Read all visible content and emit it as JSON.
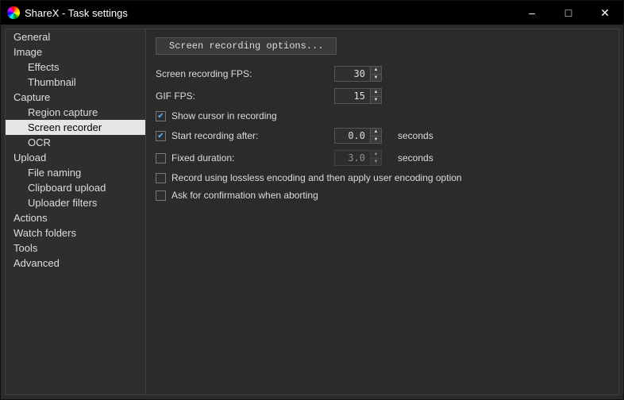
{
  "window": {
    "title": "ShareX - Task settings"
  },
  "sidebar": {
    "items": [
      {
        "label": "General",
        "child": false
      },
      {
        "label": "Image",
        "child": false
      },
      {
        "label": "Effects",
        "child": true
      },
      {
        "label": "Thumbnail",
        "child": true
      },
      {
        "label": "Capture",
        "child": false
      },
      {
        "label": "Region capture",
        "child": true
      },
      {
        "label": "Screen recorder",
        "child": true,
        "selected": true
      },
      {
        "label": "OCR",
        "child": true
      },
      {
        "label": "Upload",
        "child": false
      },
      {
        "label": "File naming",
        "child": true
      },
      {
        "label": "Clipboard upload",
        "child": true
      },
      {
        "label": "Uploader filters",
        "child": true
      },
      {
        "label": "Actions",
        "child": false
      },
      {
        "label": "Watch folders",
        "child": false
      },
      {
        "label": "Tools",
        "child": false
      },
      {
        "label": "Advanced",
        "child": false
      }
    ]
  },
  "content": {
    "options_button": "Screen recording options...",
    "fps_label": "Screen recording FPS:",
    "fps_value": "30",
    "gif_fps_label": "GIF FPS:",
    "gif_fps_value": "15",
    "show_cursor": {
      "label": "Show cursor in recording",
      "checked": true
    },
    "start_after": {
      "label": "Start recording after:",
      "checked": true,
      "value": "0.0",
      "suffix": "seconds"
    },
    "fixed_duration": {
      "label": "Fixed duration:",
      "checked": false,
      "value": "3.0",
      "suffix": "seconds"
    },
    "lossless": {
      "label": "Record using lossless encoding and then apply user encoding option",
      "checked": false
    },
    "ask_confirm": {
      "label": "Ask for confirmation when aborting",
      "checked": false
    }
  }
}
